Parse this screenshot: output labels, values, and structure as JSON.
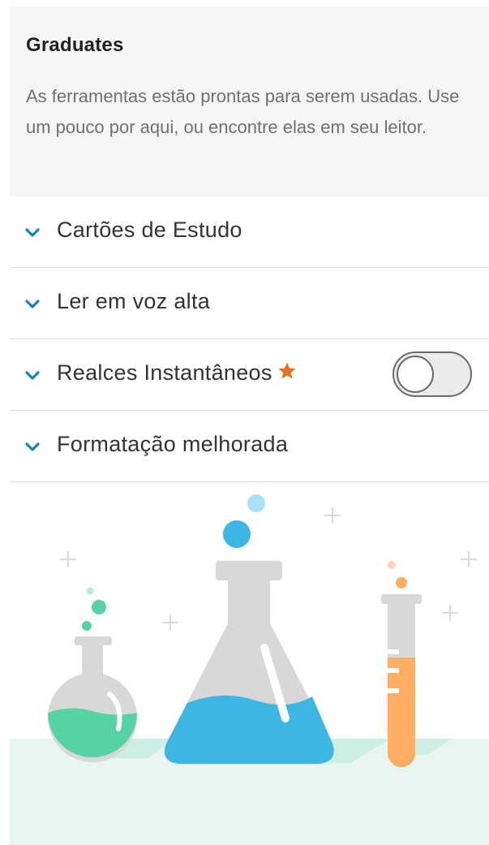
{
  "header": {
    "title": "Graduates",
    "description": "As ferramentas estão prontas para serem usadas. Use um pouco por aqui, ou encontre elas em seu leitor."
  },
  "tools": [
    {
      "label": "Cartões de Estudo",
      "icon": "chevron-down-icon"
    },
    {
      "label": "Ler em voz alta",
      "icon": "chevron-down-icon"
    },
    {
      "label": "Realces Instantâneos",
      "icon": "chevron-down-icon",
      "badge_icon": "star-icon",
      "toggle": {
        "state": "off"
      }
    },
    {
      "label": "Formatação melhorada",
      "icon": "chevron-down-icon"
    }
  ],
  "colors": {
    "accent_chevron": "#1a7fc1",
    "star": "#e8731f",
    "header_bg": "#f5f5f5",
    "ground": "#e7f6f1",
    "flask_green": "#56d3a4",
    "flask_blue": "#3db6e4",
    "tube_orange": "#feae64",
    "glass_grey": "#d8d8d8"
  },
  "illustration": {
    "name": "laboratory-flasks-illustration"
  }
}
